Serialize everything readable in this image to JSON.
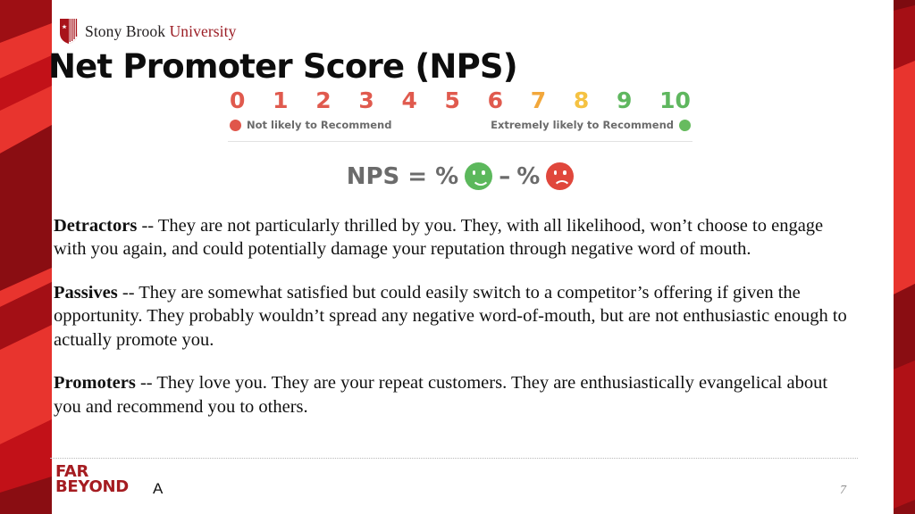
{
  "branding": {
    "university_name_part1": "Stony Brook",
    "university_name_part2": "University",
    "shield_icon": "shield-icon",
    "accent_red": "#9b1c24",
    "band_red": "#b01116"
  },
  "header": {
    "title": "Net Promoter Score (NPS)"
  },
  "nps_scale": {
    "numbers": [
      "0",
      "1",
      "2",
      "3",
      "4",
      "5",
      "6",
      "7",
      "8",
      "9",
      "10"
    ],
    "number_colors": [
      "#e05a4e",
      "#e05a4e",
      "#e05a4e",
      "#e05a4e",
      "#e05a4e",
      "#e05a4e",
      "#e05a4e",
      "#f2a73b",
      "#f5c242",
      "#5fb75f",
      "#5fb75f"
    ],
    "left_label": "Not likely to Recommend",
    "right_label": "Extremely likely to Recommend",
    "left_face_icon": "sad-face-icon",
    "right_face_icon": "happy-face-icon",
    "left_face_color": "#e0564b",
    "right_face_color": "#67bb5f",
    "label_color": "#6b6b6b"
  },
  "formula": {
    "lead": "NPS = %",
    "operator": "–",
    "second": "%",
    "happy_face_icon": "happy-face-icon",
    "sad_face_icon": "sad-face-icon",
    "happy_color": "#5cb85c",
    "sad_color": "#e0473c",
    "text_color": "#6b6b6b"
  },
  "content": {
    "paragraphs": [
      {
        "term": "Detractors",
        "text": " -- They are not particularly thrilled by you. They, with all likelihood, won’t choose to engage with you again, and could potentially damage your reputation through negative word of mouth."
      },
      {
        "term": "Passives",
        "text": " -- They are somewhat satisfied but could easily switch to a competitor’s offering if given the opportunity. They probably wouldn’t spread any negative word-of-mouth, but are not enthusiastic enough to actually promote you."
      },
      {
        "term": "Promoters",
        "text": " -- They love you. They are your repeat customers. They are enthusiastically evangelical about you and recommend you to others."
      }
    ]
  },
  "footer": {
    "tagline_line1": "FAR",
    "tagline_line2": "BEYOND",
    "mark": "A",
    "page_number": "7",
    "tagline_color": "#a51c21"
  }
}
